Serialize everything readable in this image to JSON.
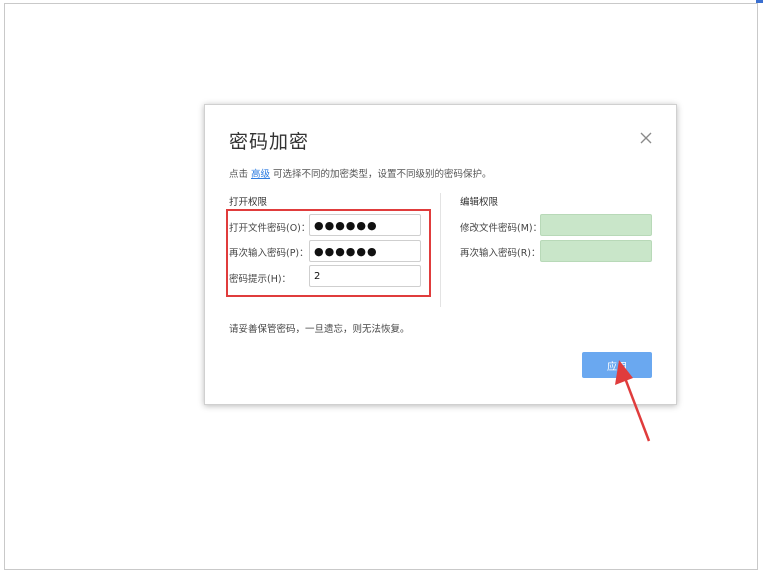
{
  "dialog": {
    "title": "密码加密",
    "hint_prefix": "点击",
    "hint_link": "高级",
    "hint_suffix": "可选择不同的加密类型，设置不同级别的密码保护。",
    "open_section": {
      "title": "打开权限",
      "open_password_label": "打开文件密码(O)：",
      "open_password_value": "●●●●●●",
      "confirm_password_label": "再次输入密码(P)：",
      "confirm_password_value": "●●●●●●",
      "hint_label": "密码提示(H)：",
      "hint_value": "2"
    },
    "edit_section": {
      "title": "编辑权限",
      "modify_password_label": "修改文件密码(M)：",
      "modify_password_value": "",
      "confirm_password_label": "再次输入密码(R)：",
      "confirm_password_value": ""
    },
    "warning": "请妥善保管密码，一旦遗忘，则无法恢复。",
    "apply_label": "应用",
    "close_icon": "close-icon"
  },
  "colors": {
    "highlight_border": "#e03c3c",
    "arrow": "#e03c3c",
    "apply_button": "#6aa8f0",
    "edit_field_fill": "#c9e6c9",
    "link": "#2f7de1"
  }
}
